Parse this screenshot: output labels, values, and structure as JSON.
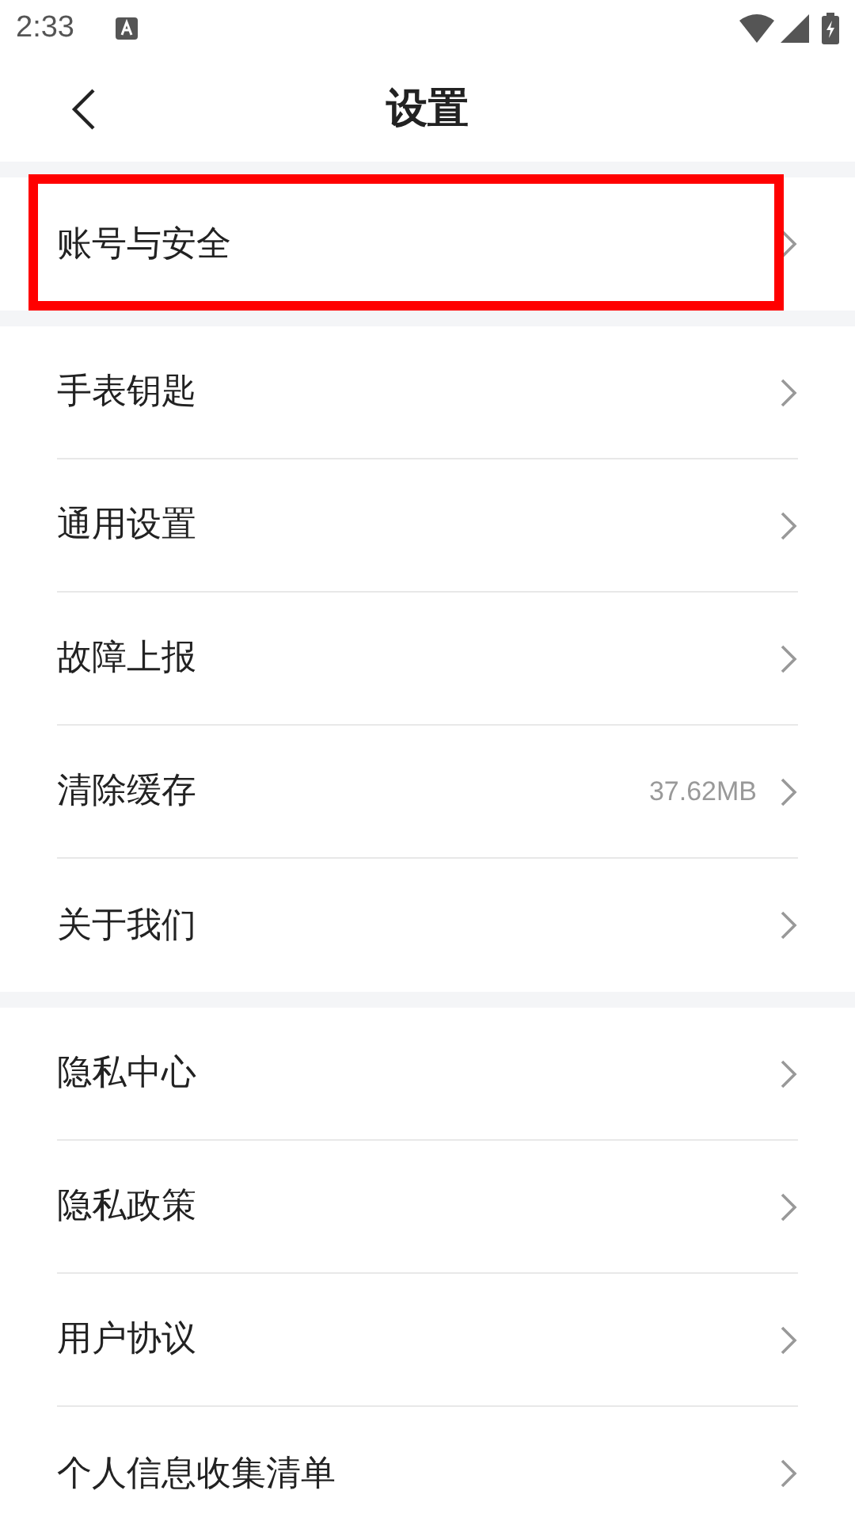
{
  "status_bar": {
    "time": "2:33"
  },
  "header": {
    "title": "设置"
  },
  "groups": [
    {
      "items": [
        {
          "label": "账号与安全",
          "highlighted": true
        }
      ]
    },
    {
      "items": [
        {
          "label": "手表钥匙",
          "highlighted": false
        },
        {
          "label": "通用设置",
          "highlighted": false
        },
        {
          "label": "故障上报",
          "highlighted": false
        },
        {
          "label": "清除缓存",
          "value": "37.62MB",
          "highlighted": false
        },
        {
          "label": "关于我们",
          "highlighted": false
        }
      ]
    },
    {
      "items": [
        {
          "label": "隐私中心",
          "highlighted": false
        },
        {
          "label": "隐私政策",
          "highlighted": false
        },
        {
          "label": "用户协议",
          "highlighted": false
        },
        {
          "label": "个人信息收集清单",
          "highlighted": false
        }
      ]
    }
  ]
}
